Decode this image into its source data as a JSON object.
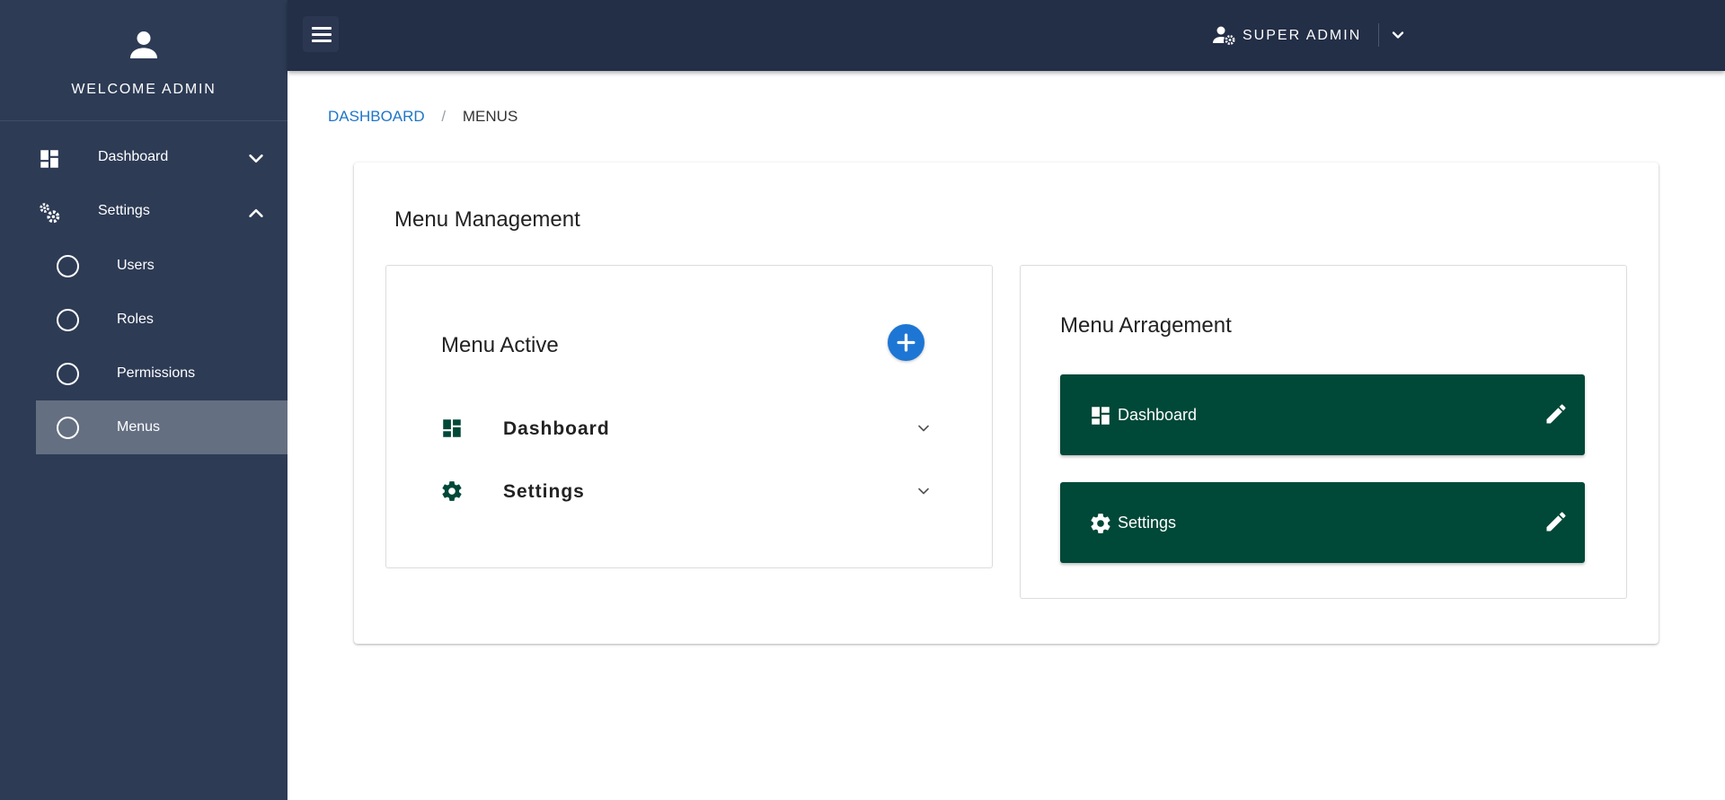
{
  "sidebar": {
    "welcome": "WELCOME ADMIN",
    "items": [
      {
        "label": "Dashboard",
        "icon": "dashboard-icon",
        "expanded": false
      },
      {
        "label": "Settings",
        "icon": "settings-icon",
        "expanded": true
      }
    ],
    "sub_items": [
      {
        "label": "Users",
        "active": false
      },
      {
        "label": "Roles",
        "active": false
      },
      {
        "label": "Permissions",
        "active": false
      },
      {
        "label": "Menus",
        "active": true
      }
    ]
  },
  "topbar": {
    "user_name": "SUPER ADMIN",
    "user_icon": "user-cog-icon"
  },
  "breadcrumb": {
    "link": "DASHBOARD",
    "separator": "/",
    "current": "MENUS"
  },
  "main": {
    "title": "Menu Management",
    "menu_active": {
      "title": "Menu Active",
      "items": [
        {
          "label": "Dashboard",
          "icon": "dashboard-icon"
        },
        {
          "label": "Settings",
          "icon": "gear-icon"
        }
      ]
    },
    "menu_arrangement": {
      "title": "Menu Arragement",
      "items": [
        {
          "label": "Dashboard",
          "icon": "dashboard-icon"
        },
        {
          "label": "Settings",
          "icon": "gear-icon"
        }
      ]
    }
  },
  "colors": {
    "sidebar_bg": "#2d3b55",
    "topbar_bg": "#232e47",
    "active_sub_bg": "#646f82",
    "link_blue": "#1e76c8",
    "add_button_blue": "#1e76d4",
    "brand_green": "#004838"
  }
}
